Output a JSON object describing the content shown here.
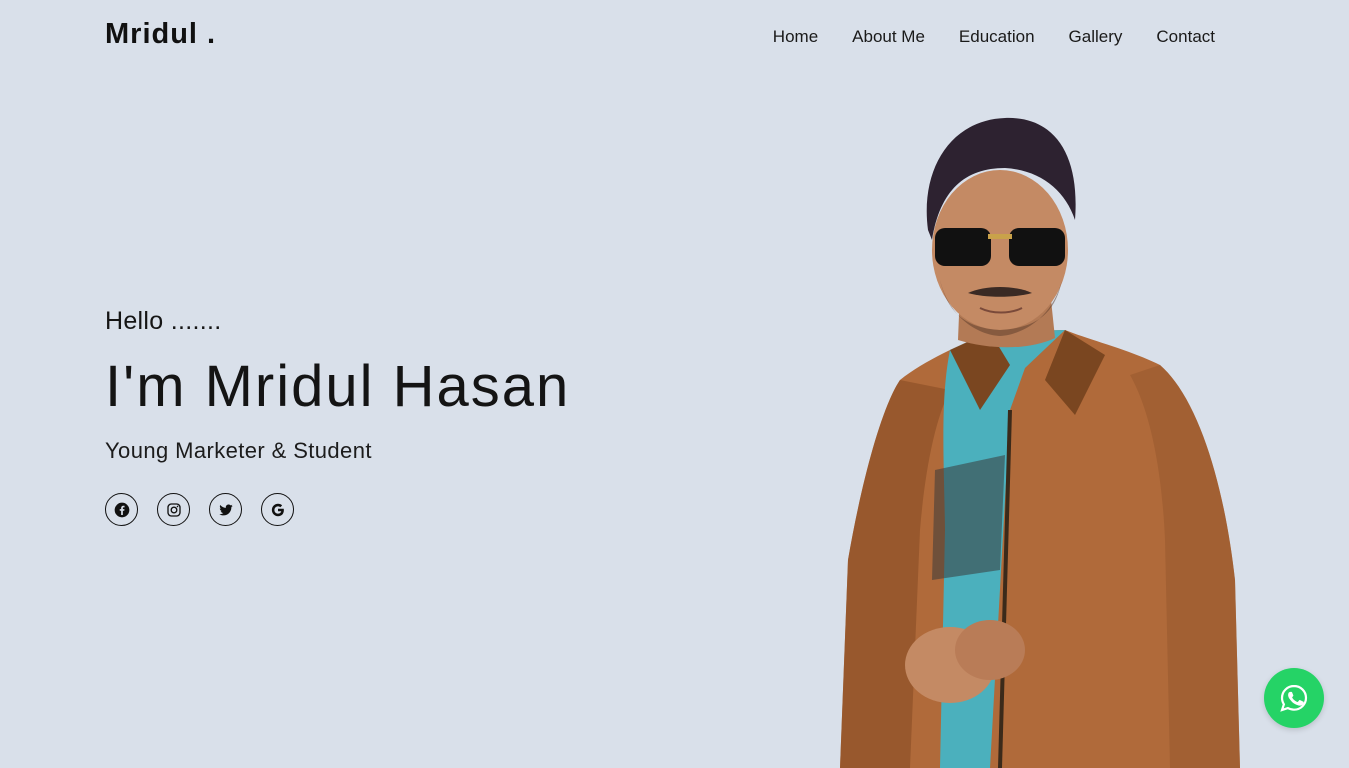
{
  "header": {
    "logo": "Mridul .",
    "nav": [
      {
        "label": "Home"
      },
      {
        "label": "About Me"
      },
      {
        "label": "Education"
      },
      {
        "label": "Gallery"
      },
      {
        "label": "Contact"
      }
    ]
  },
  "hero": {
    "greeting": "Hello .......",
    "name": "I'm Mridul Hasan",
    "subtitle": "Young Marketer & Student"
  },
  "socials": [
    {
      "icon": "facebook-icon"
    },
    {
      "icon": "instagram-icon"
    },
    {
      "icon": "twitter-icon"
    },
    {
      "icon": "google-icon"
    }
  ],
  "colors": {
    "background": "#d9e0ea",
    "text": "#111111",
    "whatsapp": "#25d366",
    "jacket": "#b06a3a"
  },
  "floating": {
    "icon": "whatsapp-icon"
  }
}
